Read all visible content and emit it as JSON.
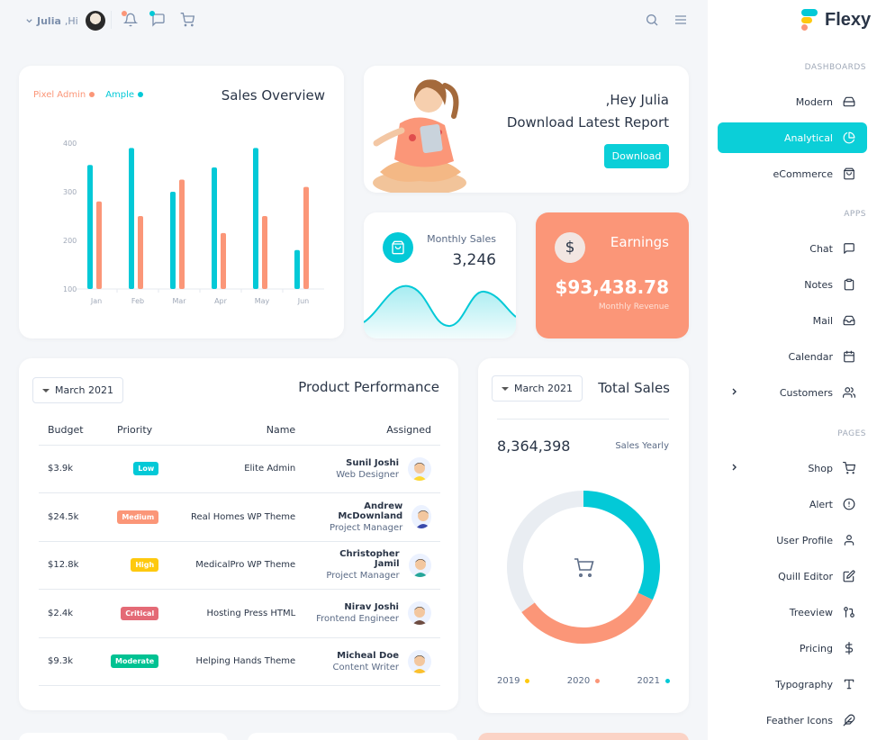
{
  "header": {
    "user_name": "Julia",
    "greeting": ",Hi"
  },
  "brand": {
    "name": "Flexy"
  },
  "sidebar": {
    "sections": [
      {
        "caption": "DASHBOARDS",
        "items": [
          {
            "label": "Modern",
            "icon": "hard-drive-icon",
            "active": false,
            "expandable": false
          },
          {
            "label": "Analytical",
            "icon": "pie-chart-icon",
            "active": true,
            "expandable": false
          },
          {
            "label": "eCommerce",
            "icon": "shopping-bag-icon",
            "active": false,
            "expandable": false
          }
        ]
      },
      {
        "caption": "APPS",
        "items": [
          {
            "label": "Chat",
            "icon": "message-square-icon",
            "active": false,
            "expandable": false
          },
          {
            "label": "Notes",
            "icon": "clipboard-icon",
            "active": false,
            "expandable": false
          },
          {
            "label": "Mail",
            "icon": "inbox-icon",
            "active": false,
            "expandable": false
          },
          {
            "label": "Calendar",
            "icon": "calendar-icon",
            "active": false,
            "expandable": false
          },
          {
            "label": "Customers",
            "icon": "users-icon",
            "active": false,
            "expandable": true
          }
        ]
      },
      {
        "caption": "PAGES",
        "items": [
          {
            "label": "Shop",
            "icon": "shopping-cart-icon",
            "active": false,
            "expandable": true
          },
          {
            "label": "Alert",
            "icon": "alert-circle-icon",
            "active": false,
            "expandable": false
          },
          {
            "label": "User Profile",
            "icon": "user-icon",
            "active": false,
            "expandable": false
          },
          {
            "label": "Quill Editor",
            "icon": "edit-icon",
            "active": false,
            "expandable": false
          },
          {
            "label": "Treeview",
            "icon": "git-pull-request-icon",
            "active": false,
            "expandable": false
          },
          {
            "label": "Pricing",
            "icon": "dollar-sign-icon",
            "active": false,
            "expandable": false
          },
          {
            "label": "Typography",
            "icon": "type-icon",
            "active": false,
            "expandable": false
          },
          {
            "label": "Feather Icons",
            "icon": "feather-icon",
            "active": false,
            "expandable": false
          }
        ]
      }
    ]
  },
  "sales_overview": {
    "title": "Sales Overview",
    "legend": [
      {
        "name": "Pixel Admin",
        "color": "#fb9678"
      },
      {
        "name": "Ample",
        "color": "#03c9d7"
      }
    ]
  },
  "chart_data": {
    "type": "bar",
    "title": "Sales Overview",
    "categories": [
      "Jan",
      "Feb",
      "Mar",
      "Apr",
      "May",
      "Jun"
    ],
    "series": [
      {
        "name": "Ample",
        "color": "#03c9d7",
        "values": [
          355,
          390,
          300,
          350,
          390,
          180
        ]
      },
      {
        "name": "Pixel Admin",
        "color": "#fb9678",
        "values": [
          280,
          250,
          325,
          215,
          250,
          310
        ]
      }
    ],
    "y_ticks": [
      100,
      200,
      300,
      400
    ],
    "ylim": [
      100,
      400
    ],
    "grid": false,
    "legend_position": "top-left"
  },
  "report": {
    "greeting": ",Hey Julia",
    "title": "Download Latest Report",
    "button": "Download"
  },
  "monthly_sales": {
    "label": "Monthly Sales",
    "value": "3,246"
  },
  "earnings": {
    "title": "Earnings",
    "value": "$93,438.78",
    "subtitle": "Monthly Revenue"
  },
  "product_performance": {
    "title": "Product Performance",
    "month": "March 2021",
    "columns": [
      "Budget",
      "Priority",
      "Name",
      "Assigned"
    ],
    "rows": [
      {
        "budget": "$3.9k",
        "priority": "Low",
        "priority_color": "#03c9d7",
        "name": "Elite Admin",
        "person": "Sunil Joshi",
        "role": "Web Designer"
      },
      {
        "budget": "$24.5k",
        "priority": "Medium",
        "priority_color": "#fb9678",
        "name": "Real Homes WP Theme",
        "person": "Andrew McDownland",
        "role": "Project Manager"
      },
      {
        "budget": "$12.8k",
        "priority": "High",
        "priority_color": "#fec90f",
        "name": "MedicalPro WP Theme",
        "person": "Christopher Jamil",
        "role": "Project Manager"
      },
      {
        "budget": "$2.4k",
        "priority": "Critical",
        "priority_color": "#e46a76",
        "name": "Hosting Press HTML",
        "person": "Nirav Joshi",
        "role": "Frontend Engineer"
      },
      {
        "budget": "$9.3k",
        "priority": "Moderate",
        "priority_color": "#00c292",
        "name": "Helping Hands Theme",
        "person": "Micheal Doe",
        "role": "Content Writer"
      }
    ]
  },
  "total_sales": {
    "title": "Total Sales",
    "month": "March 2021",
    "value": "8,364,398",
    "caption": "Sales Yearly",
    "legend": [
      {
        "name": "2019",
        "color": "#fec90f"
      },
      {
        "name": "2020",
        "color": "#fb9678"
      },
      {
        "name": "2021",
        "color": "#03c9d7"
      }
    ],
    "donut_fractions": [
      0.35,
      0.33,
      0.32
    ]
  }
}
